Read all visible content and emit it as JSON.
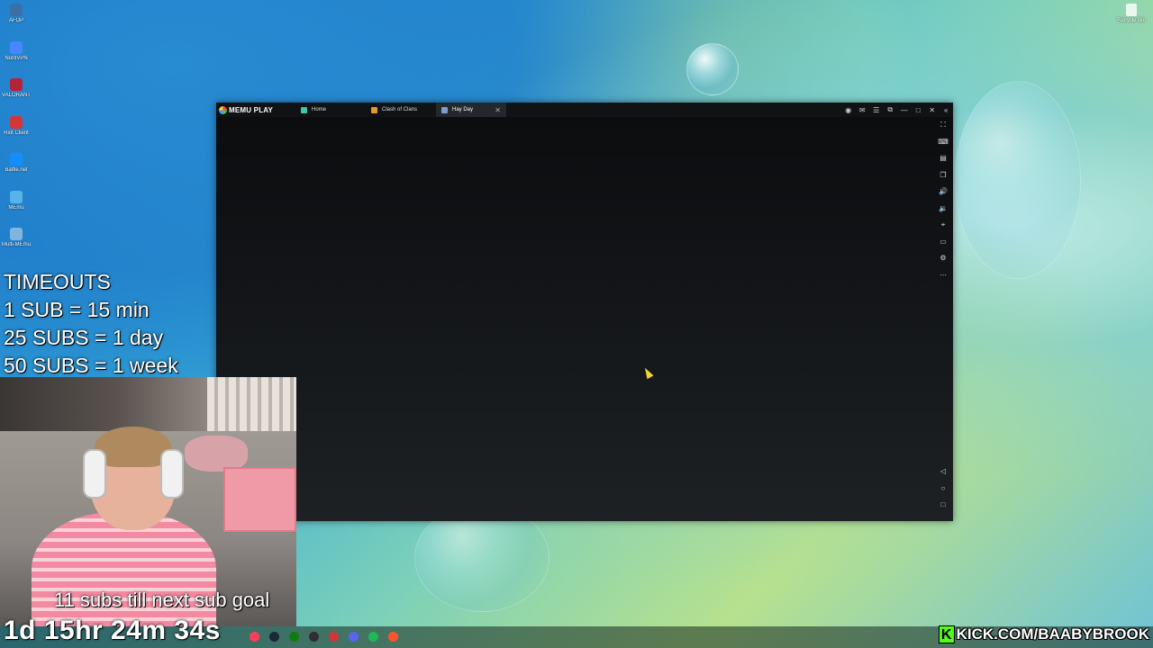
{
  "desktop": {
    "icons": [
      {
        "label": "AFOP",
        "icon": "app-icon",
        "color": "#3a6fa8"
      },
      {
        "label": "NordVPN",
        "icon": "nordvpn-icon",
        "color": "#4687ff"
      },
      {
        "label": "VALORANT",
        "icon": "valorant-icon",
        "color": "#b3243b"
      },
      {
        "label": "Riot Client",
        "icon": "riot-icon",
        "color": "#d13639"
      },
      {
        "label": "Battle.net",
        "icon": "battlenet-icon",
        "color": "#148eff"
      },
      {
        "label": "MEmu",
        "icon": "memu-icon",
        "color": "#56b4e9"
      },
      {
        "label": "Multi-MEmu",
        "icon": "multi-memu-icon",
        "color": "#7fb6e0"
      }
    ],
    "recycle_bin": "Recycle Bin"
  },
  "emulator": {
    "brand": "MEMU PLAY",
    "tabs": [
      {
        "label": "Home",
        "icon": "home-tab-icon",
        "color": "#3ec6a8",
        "active": false
      },
      {
        "label": "Clash of Clans",
        "icon": "clash-of-clans-icon",
        "color": "#e39a2b",
        "active": false
      },
      {
        "label": "Hay Day",
        "icon": "hay-day-icon",
        "color": "#7aa0c9",
        "active": true
      }
    ],
    "tab_close": "✕",
    "window_controls": [
      {
        "name": "account-icon",
        "glyph": "◉"
      },
      {
        "name": "mail-icon",
        "glyph": "✉"
      },
      {
        "name": "menu-icon",
        "glyph": "☰"
      },
      {
        "name": "restore-icon",
        "glyph": "⧉"
      },
      {
        "name": "minimize-icon",
        "glyph": "—"
      },
      {
        "name": "maximize-icon",
        "glyph": "□"
      },
      {
        "name": "close-icon",
        "glyph": "✕"
      },
      {
        "name": "collapse-sidebar-icon",
        "glyph": "«"
      }
    ],
    "sidebar_top": [
      {
        "name": "fullscreen-icon",
        "glyph": "⛶"
      },
      {
        "name": "keyboard-icon",
        "glyph": "⌨"
      },
      {
        "name": "apk-install-icon",
        "glyph": "▤"
      },
      {
        "name": "multi-window-icon",
        "glyph": "❐"
      },
      {
        "name": "volume-up-icon",
        "glyph": "🔊"
      },
      {
        "name": "volume-down-icon",
        "glyph": "🔉"
      },
      {
        "name": "location-icon",
        "glyph": "⌖"
      },
      {
        "name": "folder-icon",
        "glyph": "▭"
      },
      {
        "name": "settings-icon",
        "glyph": "⚙"
      },
      {
        "name": "more-icon",
        "glyph": "⋯"
      }
    ],
    "sidebar_bottom": [
      {
        "name": "back-icon",
        "glyph": "◁"
      },
      {
        "name": "home-icon",
        "glyph": "○"
      },
      {
        "name": "recents-icon",
        "glyph": "□"
      }
    ]
  },
  "overlay": {
    "timeouts_lines": [
      "TIMEOUTS",
      "1 SUB = 15 min",
      "25 SUBS = 1 day",
      "50 SUBS = 1 week"
    ],
    "sub_goal": "11 subs till next sub goal",
    "timer": "1d 15hr 24m 34s",
    "kick_logo": "K",
    "kick_url": "KICK.COM/BAABYBROOK"
  },
  "taskbar": {
    "apps": [
      {
        "name": "opera-gx-icon",
        "color": "#ff3d5a"
      },
      {
        "name": "steam-icon",
        "color": "#1b2838"
      },
      {
        "name": "xbox-icon",
        "color": "#107c10"
      },
      {
        "name": "obs-icon",
        "color": "#302e31"
      },
      {
        "name": "riot-taskbar-icon",
        "color": "#d13639"
      },
      {
        "name": "discord-icon",
        "color": "#5865f2"
      },
      {
        "name": "spotify-icon",
        "color": "#1db954"
      },
      {
        "name": "brave-icon",
        "color": "#fb542b"
      }
    ]
  }
}
